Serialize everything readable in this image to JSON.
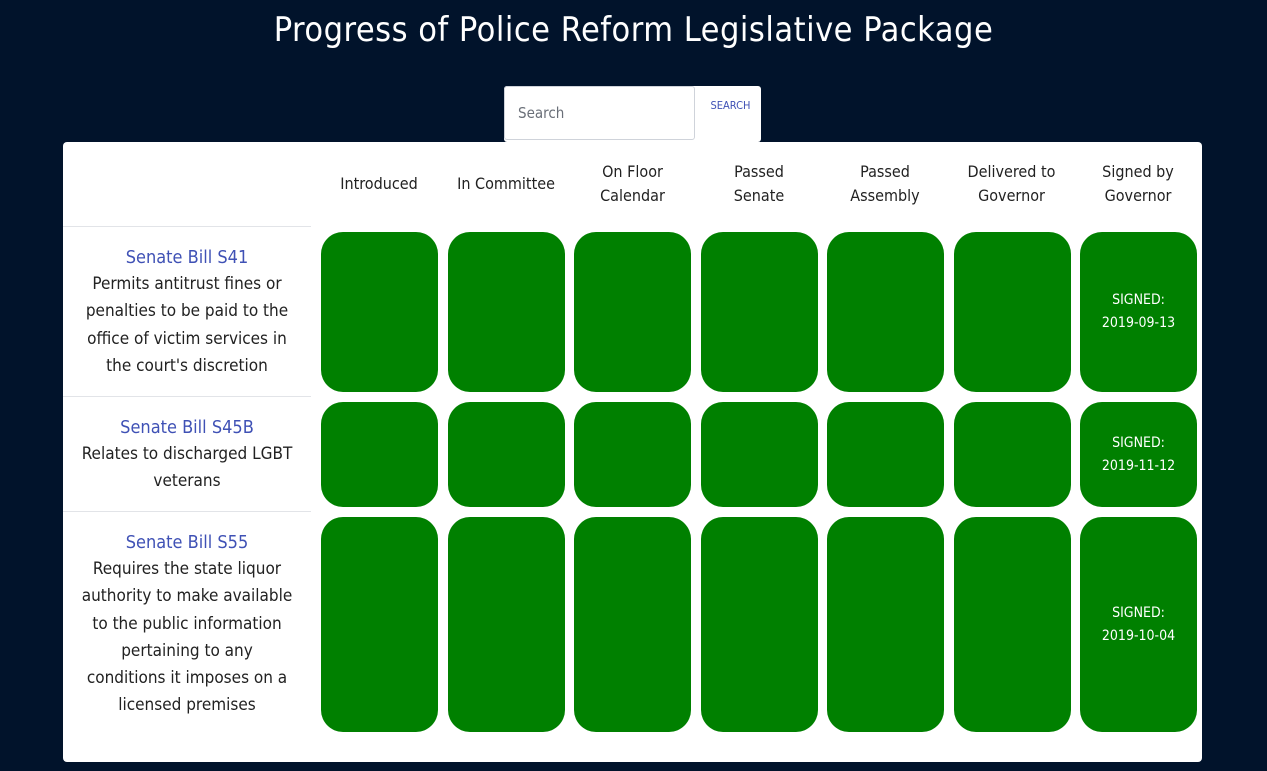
{
  "page": {
    "title": "Progress of Police Reform Legislative Package"
  },
  "search": {
    "placeholder": "Search",
    "value": "",
    "button_label": "SEARCH"
  },
  "columns": [
    "Introduced",
    "In Committee",
    "On Floor Calendar",
    "Passed Senate",
    "Passed Assembly",
    "Delivered to Governor",
    "Signed by Governor"
  ],
  "bills": [
    {
      "name": "Senate Bill S41",
      "description": "Permits antitrust fines or penalties to be paid to the office of victim services in the court's discretion",
      "signed_label": "SIGNED:",
      "signed_date": "2019-09-13"
    },
    {
      "name": "Senate Bill S45B",
      "description": "Relates to discharged LGBT veterans",
      "signed_label": "SIGNED:",
      "signed_date": "2019-11-12"
    },
    {
      "name": "Senate Bill S55",
      "description": "Requires the state liquor authority to make available to the public information pertaining to any conditions it imposes on a licensed premises",
      "signed_label": "SIGNED:",
      "signed_date": "2019-10-04"
    }
  ],
  "colors": {
    "background": "#01132b",
    "stage_complete": "#008000",
    "link": "#3f51b5"
  }
}
